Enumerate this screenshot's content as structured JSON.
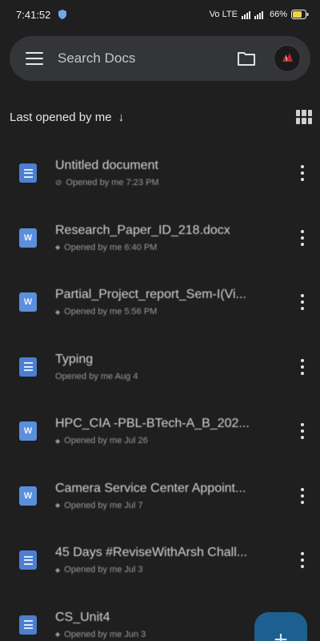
{
  "status_bar": {
    "time": "7:41:52",
    "network": "Vo LTE",
    "battery": "66%"
  },
  "search": {
    "placeholder": "Search Docs"
  },
  "sort": {
    "label": "Last opened by me",
    "arrow": "↓"
  },
  "documents": [
    {
      "title": "Untitled document",
      "meta": "Opened by me 7:23 PM",
      "icon": "google-doc",
      "meta_icon": "offline"
    },
    {
      "title": "Research_Paper_ID_218.docx",
      "meta": "Opened by me 6:40 PM",
      "icon": "word",
      "meta_icon": "shared"
    },
    {
      "title": "Partial_Project_report_Sem-I(Vi...",
      "meta": "Opened by me 5:56 PM",
      "icon": "word",
      "meta_icon": "shared"
    },
    {
      "title": "Typing",
      "meta": "Opened by me Aug 4",
      "icon": "google-doc",
      "meta_icon": ""
    },
    {
      "title": "HPC_CIA -PBL-BTech-A_B_202...",
      "meta": "Opened by me Jul 26",
      "icon": "word",
      "meta_icon": "shared"
    },
    {
      "title": "Camera Service Center Appoint...",
      "meta": "Opened by me Jul 7",
      "icon": "word",
      "meta_icon": "shared"
    },
    {
      "title": "45 Days #ReviseWithArsh Chall...",
      "meta": "Opened by me Jul 3",
      "icon": "google-doc",
      "meta_icon": "shared"
    },
    {
      "title": "CS_Unit4",
      "meta": "Opened by me Jun 3",
      "icon": "google-doc",
      "meta_icon": "shared"
    }
  ],
  "fab": {
    "label": "+"
  },
  "colors": {
    "background": "#1f1f1f",
    "search_bar": "#333538",
    "doc_icon": "#4c7fd1",
    "fab": "#1d5f8f"
  }
}
